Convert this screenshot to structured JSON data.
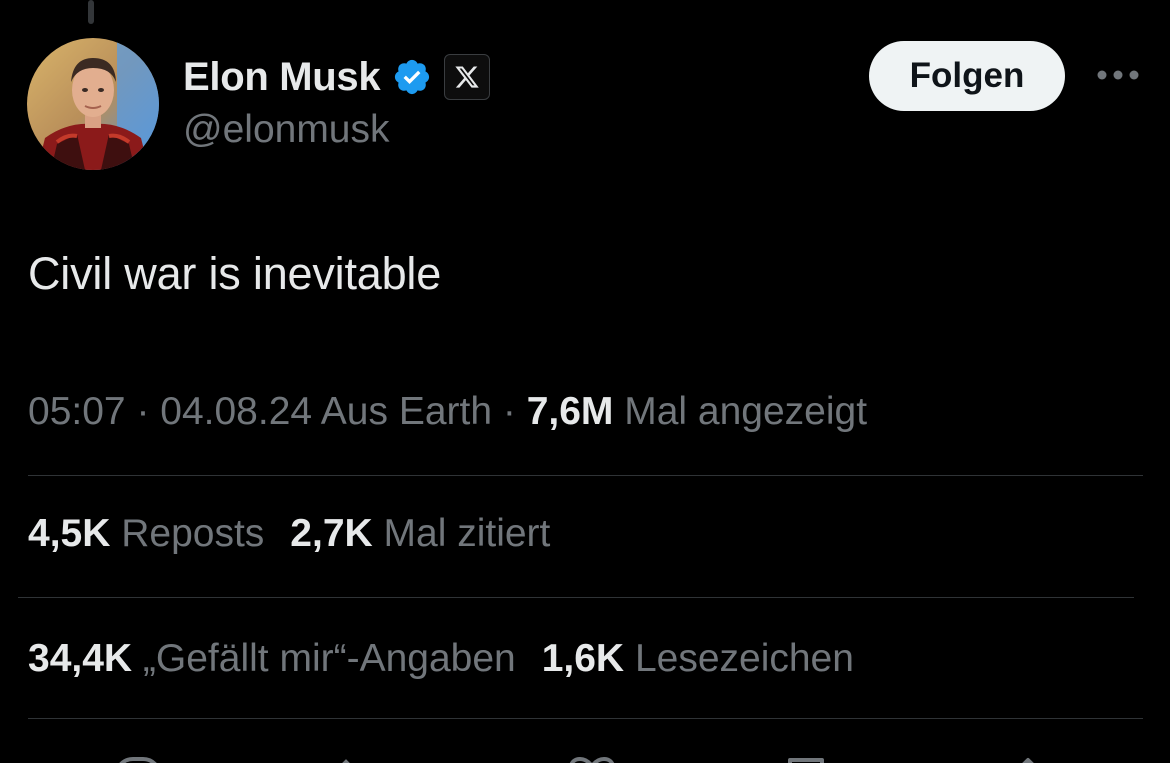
{
  "author": {
    "display_name": "Elon Musk",
    "handle": "@elonmusk",
    "verified": true,
    "affiliation_badge": "x-logo-icon"
  },
  "follow_button": {
    "label": "Folgen"
  },
  "tweet": {
    "text": "Civil war is inevitable"
  },
  "meta": {
    "time": "05:07",
    "sep1": " · ",
    "date": "04.08.24",
    "location": " Aus Earth",
    "sep2": " · ",
    "views_count": "7,6M",
    "views_label": " Mal angezeigt"
  },
  "stats_row1": {
    "reposts_count": "4,5K",
    "reposts_label": " Reposts",
    "quotes_count": "2,7K",
    "quotes_label": " Mal zitiert"
  },
  "stats_row2": {
    "likes_count": "34,4K",
    "likes_label": " „Gefällt mir“-Angaben",
    "bookmarks_count": "1,6K",
    "bookmarks_label": " Lesezeichen"
  },
  "colors": {
    "background": "#000000",
    "primary_text": "#e7e9ea",
    "secondary_text": "#71767b",
    "divider": "#2f3336",
    "verified_blue": "#1d9bf0",
    "follow_button_bg": "#eff3f4"
  },
  "icons": {
    "verified": "verified-badge-icon",
    "more": "more-dots-icon",
    "actions": [
      "reply-icon",
      "repost-icon",
      "like-icon",
      "bookmark-icon",
      "share-icon"
    ]
  }
}
